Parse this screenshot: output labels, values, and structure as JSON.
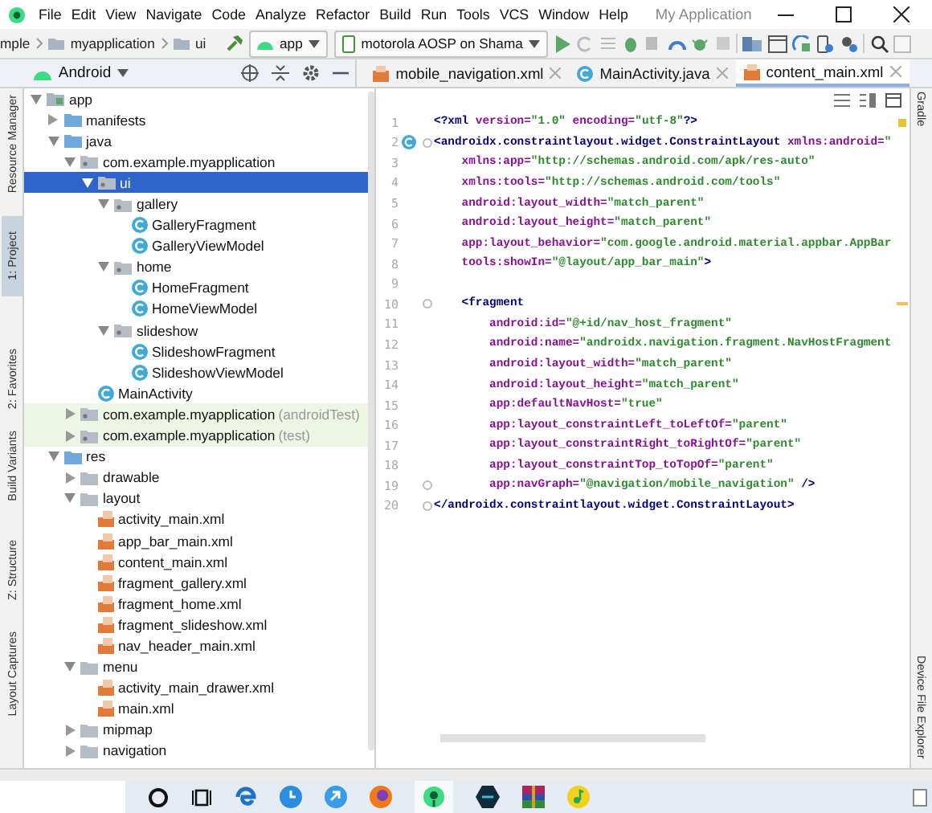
{
  "window": {
    "title": "My Application"
  },
  "menus": [
    "File",
    "Edit",
    "View",
    "Navigate",
    "Code",
    "Analyze",
    "Refactor",
    "Build",
    "Run",
    "Tools",
    "VCS",
    "Window",
    "Help"
  ],
  "toolbar": {
    "breadcrumb": [
      {
        "label": "mple"
      },
      {
        "label": "myapplication",
        "kind": "folder"
      },
      {
        "label": "ui",
        "kind": "folder"
      }
    ],
    "run_config": "app",
    "device": "motorola AOSP on Shama"
  },
  "left_tool_strip": [
    {
      "label": "Resource Manager",
      "selected": false
    },
    {
      "label": "1: Project",
      "selected": true
    },
    {
      "label": "2: Favorites",
      "selected": false
    },
    {
      "label": "Build Variants",
      "selected": false
    },
    {
      "label": "Z: Structure",
      "selected": false
    },
    {
      "label": "Layout Captures",
      "selected": false
    }
  ],
  "right_tool_strip": [
    "Gradle",
    "Device File Explorer"
  ],
  "project": {
    "view": "Android",
    "tree": [
      {
        "label": "app",
        "kind": "module",
        "expanded": true,
        "selected": false,
        "children": [
          {
            "label": "manifests",
            "kind": "source",
            "expanded": false,
            "selected": false
          },
          {
            "label": "java",
            "kind": "source",
            "expanded": true,
            "selected": false,
            "children": [
              {
                "label": "com.example.myapplication",
                "kind": "package",
                "expanded": true,
                "selected": false,
                "children": [
                  {
                    "label": "ui",
                    "kind": "package",
                    "expanded": true,
                    "selected": true,
                    "children": [
                      {
                        "label": "gallery",
                        "kind": "package",
                        "expanded": true,
                        "selected": false,
                        "children": [
                          {
                            "label": "GalleryFragment",
                            "kind": "class",
                            "selected": false
                          },
                          {
                            "label": "GalleryViewModel",
                            "kind": "class",
                            "selected": false
                          }
                        ]
                      },
                      {
                        "label": "home",
                        "kind": "package",
                        "expanded": true,
                        "selected": false,
                        "children": [
                          {
                            "label": "HomeFragment",
                            "kind": "class",
                            "selected": false
                          },
                          {
                            "label": "HomeViewModel",
                            "kind": "class",
                            "selected": false
                          }
                        ]
                      },
                      {
                        "label": "slideshow",
                        "kind": "package",
                        "expanded": true,
                        "selected": false,
                        "children": [
                          {
                            "label": "SlideshowFragment",
                            "kind": "class",
                            "selected": false
                          },
                          {
                            "label": "SlideshowViewModel",
                            "kind": "class",
                            "selected": false
                          }
                        ]
                      }
                    ]
                  },
                  {
                    "label": "MainActivity",
                    "kind": "class",
                    "selected": false
                  }
                ]
              },
              {
                "label": "com.example.myapplication",
                "note": "(androidTest)",
                "kind": "package",
                "expanded": false,
                "selected": false
              },
              {
                "label": "com.example.myapplication",
                "note": "(test)",
                "kind": "package",
                "expanded": false,
                "selected": false
              }
            ]
          },
          {
            "label": "res",
            "kind": "source",
            "expanded": true,
            "selected": false,
            "children": [
              {
                "label": "drawable",
                "kind": "folder",
                "expanded": false,
                "selected": false
              },
              {
                "label": "layout",
                "kind": "folder",
                "expanded": true,
                "selected": false,
                "children": [
                  {
                    "label": "activity_main.xml",
                    "kind": "xml",
                    "selected": false
                  },
                  {
                    "label": "app_bar_main.xml",
                    "kind": "xml",
                    "selected": false
                  },
                  {
                    "label": "content_main.xml",
                    "kind": "xml",
                    "selected": false
                  },
                  {
                    "label": "fragment_gallery.xml",
                    "kind": "xml",
                    "selected": false
                  },
                  {
                    "label": "fragment_home.xml",
                    "kind": "xml",
                    "selected": false
                  },
                  {
                    "label": "fragment_slideshow.xml",
                    "kind": "xml",
                    "selected": false
                  },
                  {
                    "label": "nav_header_main.xml",
                    "kind": "xml",
                    "selected": false
                  }
                ]
              },
              {
                "label": "menu",
                "kind": "folder",
                "expanded": true,
                "selected": false,
                "children": [
                  {
                    "label": "activity_main_drawer.xml",
                    "kind": "xml",
                    "selected": false
                  },
                  {
                    "label": "main.xml",
                    "kind": "xml",
                    "selected": false
                  }
                ]
              },
              {
                "label": "mipmap",
                "kind": "folder",
                "expanded": false,
                "selected": false
              },
              {
                "label": "navigation",
                "kind": "folder",
                "expanded": false,
                "selected": false
              }
            ]
          }
        ]
      }
    ]
  },
  "editor": {
    "tabs": [
      {
        "label": "mobile_navigation.xml",
        "kind": "xml",
        "selected": false
      },
      {
        "label": "MainActivity.java",
        "kind": "class",
        "selected": false
      },
      {
        "label": "content_main.xml",
        "kind": "xml",
        "selected": true
      }
    ],
    "lines": [
      {
        "number": "1",
        "warning": true,
        "tokens": [
          {
            "kind": "tag",
            "text": "<?xml "
          },
          {
            "kind": "attr",
            "text": "version="
          },
          {
            "kind": "value",
            "text": "\"1.0\""
          },
          {
            "kind": "attr",
            "text": " encoding="
          },
          {
            "kind": "value",
            "text": "\"utf-8\""
          },
          {
            "kind": "tag",
            "text": "?>"
          }
        ]
      },
      {
        "number": "2",
        "class_marker": true,
        "fold": true,
        "tokens": [
          {
            "kind": "tag",
            "text": "<androidx.constraintlayout.widget.ConstraintLayout "
          },
          {
            "kind": "attr",
            "text": "xmlns:android="
          },
          {
            "kind": "value",
            "text": "\""
          }
        ]
      },
      {
        "number": "3",
        "tokens": [
          {
            "kind": "attr",
            "text": "    xmlns:app="
          },
          {
            "kind": "value",
            "text": "\"http://schemas.android.com/apk/res-auto\""
          }
        ]
      },
      {
        "number": "4",
        "tokens": [
          {
            "kind": "attr",
            "text": "    xmlns:tools="
          },
          {
            "kind": "value",
            "text": "\"http://schemas.android.com/tools\""
          }
        ]
      },
      {
        "number": "5",
        "tokens": [
          {
            "kind": "attr",
            "text": "    android:layout_width="
          },
          {
            "kind": "value",
            "text": "\"match_parent\""
          }
        ]
      },
      {
        "number": "6",
        "tokens": [
          {
            "kind": "attr",
            "text": "    android:layout_height="
          },
          {
            "kind": "value",
            "text": "\"match_parent\""
          }
        ]
      },
      {
        "number": "7",
        "tokens": [
          {
            "kind": "attr",
            "text": "    app:layout_behavior="
          },
          {
            "kind": "value",
            "text": "\"com.google.android.material.appbar.AppBar"
          }
        ]
      },
      {
        "number": "8",
        "tokens": [
          {
            "kind": "attr",
            "text": "    tools:showIn="
          },
          {
            "kind": "value",
            "text": "\"@layout/app_bar_main\""
          },
          {
            "kind": "tag",
            "text": ">"
          }
        ]
      },
      {
        "number": "9"
      },
      {
        "number": "10",
        "fold": true,
        "typo": true,
        "tokens": [
          {
            "kind": "tag",
            "text": "    <fragment"
          }
        ]
      },
      {
        "number": "11",
        "tokens": [
          {
            "kind": "attr",
            "text": "        android:id="
          },
          {
            "kind": "value",
            "text": "\"@+id/nav_host_fragment\""
          }
        ]
      },
      {
        "number": "12",
        "tokens": [
          {
            "kind": "attr",
            "text": "        android:name="
          },
          {
            "kind": "value",
            "text": "\"androidx.navigation.fragment.NavHostFragment"
          }
        ]
      },
      {
        "number": "13",
        "tokens": [
          {
            "kind": "attr",
            "text": "        android:layout_width="
          },
          {
            "kind": "value",
            "text": "\"match_parent\""
          }
        ]
      },
      {
        "number": "14",
        "tokens": [
          {
            "kind": "attr",
            "text": "        android:layout_height="
          },
          {
            "kind": "value",
            "text": "\"match_parent\""
          }
        ]
      },
      {
        "number": "15",
        "tokens": [
          {
            "kind": "attr",
            "text": "        app:defaultNavHost="
          },
          {
            "kind": "value",
            "text": "\"true\""
          }
        ]
      },
      {
        "number": "16",
        "tokens": [
          {
            "kind": "attr",
            "text": "        app:layout_constraintLeft_toLeftOf="
          },
          {
            "kind": "value",
            "text": "\"parent\""
          }
        ]
      },
      {
        "number": "17",
        "tokens": [
          {
            "kind": "attr",
            "text": "        app:layout_constraintRight_toRightOf="
          },
          {
            "kind": "value",
            "text": "\"parent\""
          }
        ]
      },
      {
        "number": "18",
        "tokens": [
          {
            "kind": "attr",
            "text": "        app:layout_constraintTop_toTopOf="
          },
          {
            "kind": "value",
            "text": "\"parent\""
          }
        ]
      },
      {
        "number": "19",
        "fold": true,
        "tokens": [
          {
            "kind": "attr",
            "text": "        app:navGraph="
          },
          {
            "kind": "value",
            "text": "\"@navigation/mobile_navigation\""
          },
          {
            "kind": "tag",
            "text": " />"
          }
        ]
      },
      {
        "number": "20",
        "fold": true,
        "tokens": [
          {
            "kind": "tag",
            "text": "</androidx.constraintlayout.widget.ConstraintLayout>"
          }
        ]
      }
    ]
  }
}
